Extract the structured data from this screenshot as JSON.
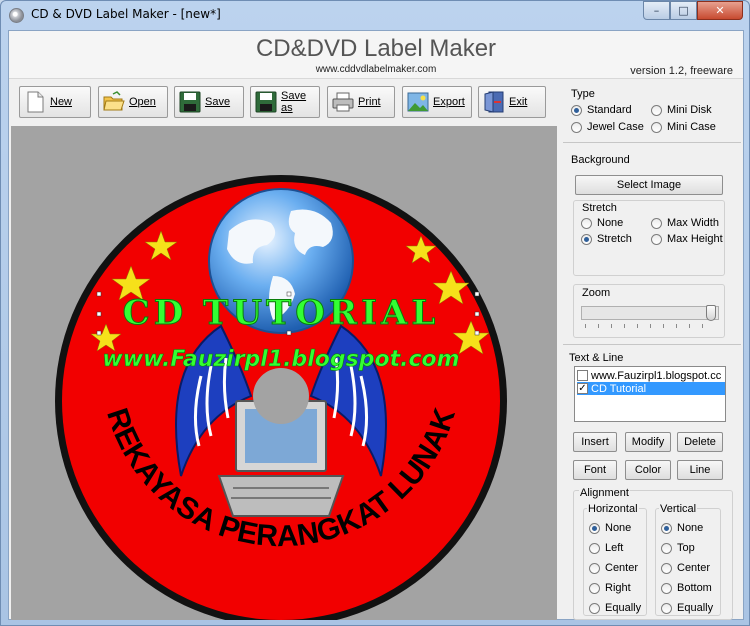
{
  "window": {
    "title": "CD & DVD Label Maker - [new*]",
    "minimize_glyph": "–",
    "maximize_glyph": "□",
    "close_glyph": "✕"
  },
  "header": {
    "title": "CD&DVD Label Maker",
    "url": "www.cddvdlabelmaker.com",
    "version": "version 1.2, freeware"
  },
  "toolbar": {
    "new_label": "New",
    "open_label": "Open",
    "save_label": "Save",
    "save_as_label": "Save as",
    "print_label": "Print",
    "export_label": "Export",
    "exit_label": "Exit"
  },
  "disc": {
    "line1": "CD TUTORIAL",
    "line2": "www.Fauzirpl1.blogspot.com",
    "ring_text": "REKAYASA PERANGKAT LUNAK",
    "colors": {
      "canvas": "#a3a3a3",
      "rim": "#111111",
      "face": "#f20000",
      "text_line": "#33ff33",
      "ring_text": "#000000"
    }
  },
  "panel": {
    "type": {
      "title": "Type",
      "options": [
        {
          "label": "Standard",
          "selected": true
        },
        {
          "label": "Mini Disk",
          "selected": false
        },
        {
          "label": "Jewel Case",
          "selected": false
        },
        {
          "label": "Mini Case",
          "selected": false
        }
      ]
    },
    "background": {
      "title": "Background",
      "select_image_label": "Select Image",
      "stretch": {
        "title": "Stretch",
        "options": [
          {
            "label": "None",
            "selected": false
          },
          {
            "label": "Max Width",
            "selected": false
          },
          {
            "label": "Stretch",
            "selected": true
          },
          {
            "label": "Max Height",
            "selected": false
          }
        ]
      },
      "zoom": {
        "title": "Zoom",
        "value": 0.95
      }
    },
    "text_line": {
      "title": "Text & Line",
      "items": [
        {
          "label": "www.Fauzirpl1.blogspot.cc",
          "checked": false,
          "selected": false
        },
        {
          "label": "CD Tutorial",
          "checked": true,
          "selected": true
        }
      ],
      "insert_label": "Insert",
      "modify_label": "Modify",
      "delete_label": "Delete",
      "font_label": "Font",
      "color_label": "Color",
      "line_label": "Line"
    },
    "alignment": {
      "title": "Alignment",
      "horizontal": {
        "title": "Horizontal",
        "options": [
          {
            "label": "None",
            "selected": true
          },
          {
            "label": "Left",
            "selected": false
          },
          {
            "label": "Center",
            "selected": false
          },
          {
            "label": "Right",
            "selected": false
          },
          {
            "label": "Equally",
            "selected": false
          }
        ]
      },
      "vertical": {
        "title": "Vertical",
        "options": [
          {
            "label": "None",
            "selected": true
          },
          {
            "label": "Top",
            "selected": false
          },
          {
            "label": "Center",
            "selected": false
          },
          {
            "label": "Bottom",
            "selected": false
          },
          {
            "label": "Equally",
            "selected": false
          }
        ]
      }
    }
  }
}
